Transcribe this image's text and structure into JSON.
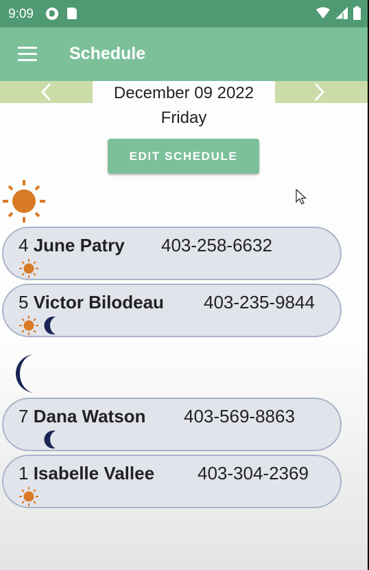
{
  "status_bar": {
    "time": "9:09"
  },
  "app_bar": {
    "title": "Schedule"
  },
  "date_nav": {
    "date": "December 09 2022",
    "day": "Friday"
  },
  "actions": {
    "edit_label": "EDIT SCHEDULE"
  },
  "colors": {
    "accent": "#7cc09a",
    "status_bar": "#4f9a72",
    "sun": "#d87a26",
    "moon": "#1a2456"
  },
  "day_section": {
    "icon": "sun-icon",
    "entries": [
      {
        "number": "4",
        "name": "June  Patry",
        "phone": "403-258-6632",
        "shifts": [
          "sun-icon"
        ]
      },
      {
        "number": "5",
        "name": "Victor  Bilodeau",
        "phone": "403-235-9844",
        "shifts": [
          "sun-icon",
          "moon-icon"
        ]
      }
    ]
  },
  "night_section": {
    "icon": "moon-icon",
    "entries": [
      {
        "number": "7",
        "name": "Dana  Watson",
        "phone": "403-569-8863",
        "shifts": [
          "moon-icon"
        ]
      },
      {
        "number": "1",
        "name": "Isabelle  Vallee",
        "phone": "403-304-2369",
        "shifts": [
          "sun-icon"
        ]
      }
    ]
  }
}
